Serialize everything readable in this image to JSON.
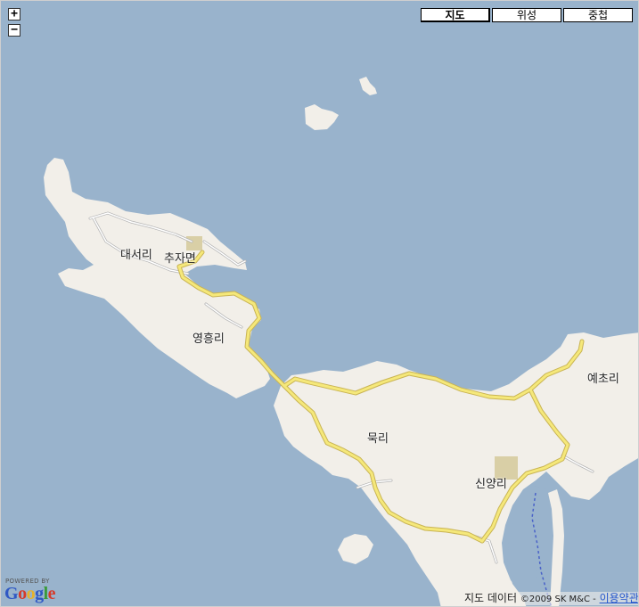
{
  "controls": {
    "zoom_in": "+",
    "zoom_out": "−",
    "map_types": [
      {
        "label": "지도",
        "active": true
      },
      {
        "label": "위성",
        "active": false
      },
      {
        "label": "중첩",
        "active": false
      }
    ]
  },
  "places": {
    "daeseo_ri": "대서리",
    "chuja_myeon": "추자면",
    "yeongheung_ri": "영흥리",
    "yechori": "예초리",
    "mukri": "묵리",
    "sinyang_ri": "신양리"
  },
  "branding": {
    "powered_by": "POWERED BY",
    "logo_letters": [
      "G",
      "o",
      "o",
      "g",
      "l",
      "e"
    ],
    "logo_colors": [
      "#2f58c4",
      "#d63a2a",
      "#e7b22a",
      "#2f58c4",
      "#3a9a3a",
      "#d63a2a"
    ]
  },
  "attribution": {
    "data_label": "지도 데이터",
    "copyright": "©2009 SK M&C -",
    "terms_link": "이용약관"
  },
  "colors": {
    "water": "#99b3cc",
    "land": "#f2efe9",
    "road": "#f5e87a",
    "road_casing": "#c9b454",
    "urban": "#d9cfa6"
  }
}
